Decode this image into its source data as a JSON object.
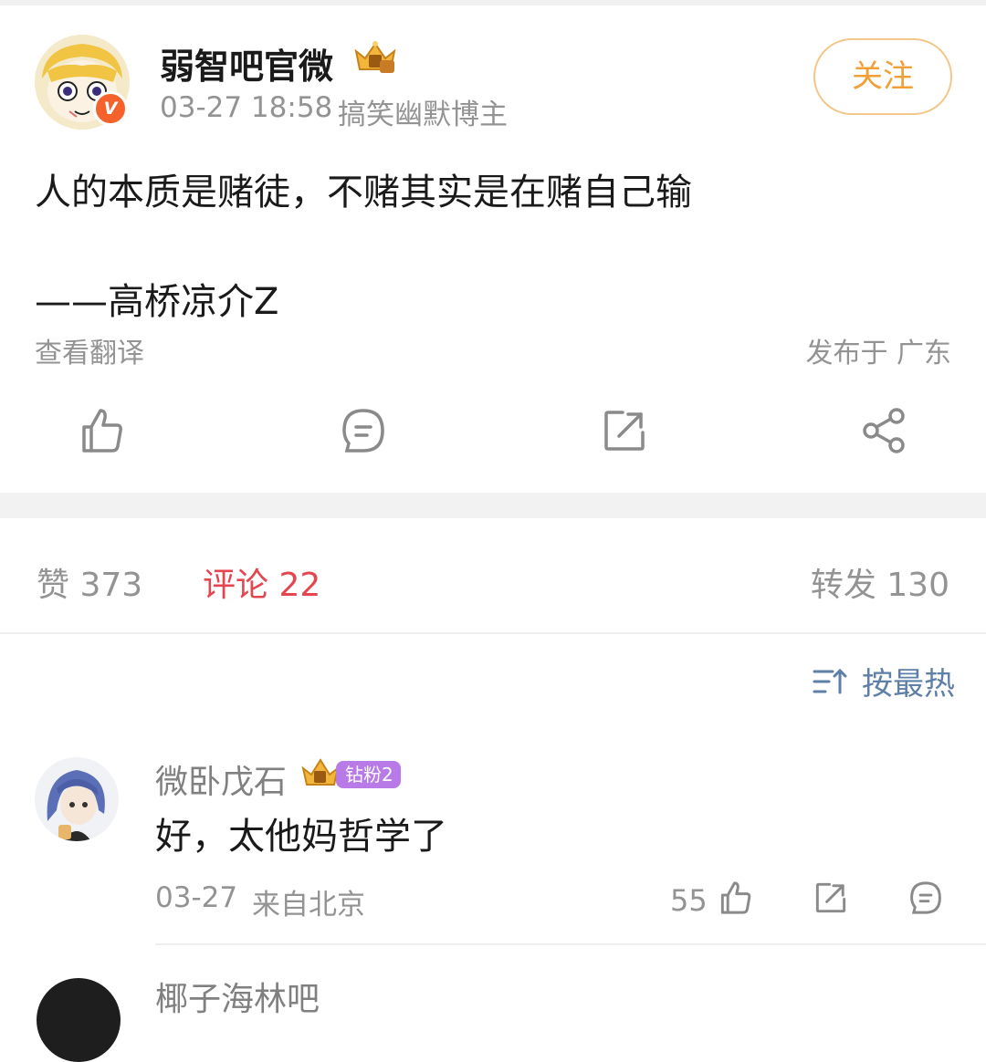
{
  "post": {
    "author": "弱智吧官微",
    "verified_mark": "V",
    "time": "03-27 18:58",
    "tag": "搞笑幽默博主",
    "follow_label": "关注",
    "content_line1": "人的本质是赌徒，不赌其实是在赌自己输",
    "content_line2": "——高桥凉介Z",
    "translate_label": "查看翻译",
    "location": "发布于 广东",
    "actions": [
      "like-icon",
      "comment-icon",
      "repost-icon",
      "share-icon"
    ]
  },
  "tabs": {
    "likes": "赞 373",
    "comments": "评论 22",
    "reposts": "转发 130"
  },
  "sort": {
    "label": "按最热",
    "icon": "sort-icon"
  },
  "comments": [
    {
      "user": "微卧戊石",
      "badge": "钻粉2",
      "text": "好，太他妈哲学了",
      "date": "03-27",
      "from": "来自北京",
      "likes": "55"
    }
  ],
  "next_comment": {
    "user": "椰子海林吧"
  },
  "colors": {
    "accent_orange": "#f0a036",
    "comment_red": "#e4464f",
    "sort_blue": "#5e7fa8",
    "verified_orange": "#f5622c",
    "fan_badge_purple": "#b77ae6"
  }
}
